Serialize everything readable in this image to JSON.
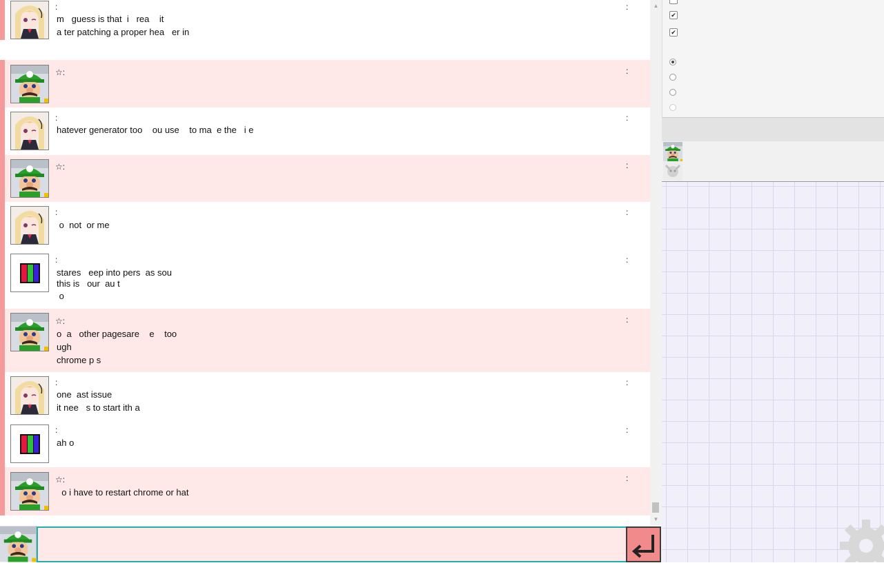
{
  "chat": {
    "messages": [
      {
        "style": "white",
        "avatar": "girl",
        "name": ":",
        "time": ":",
        "lines": [
          "m   guess is that  i   rea    it",
          "a ter patching a proper hea   er in"
        ]
      },
      {
        "style": "pink",
        "avatar": "luigi",
        "name": "☆:",
        "time": ":",
        "lines": []
      },
      {
        "style": "white",
        "avatar": "girl",
        "name": ":",
        "time": ":",
        "lines": [
          "hatever generator too    ou use    to ma  e the   i e"
        ]
      },
      {
        "style": "pink",
        "avatar": "luigi",
        "name": "☆:",
        "time": ":",
        "lines": []
      },
      {
        "style": "white",
        "avatar": "girl",
        "name": ":",
        "time": ":",
        "lines": [
          " o  not  or me"
        ]
      },
      {
        "style": "white",
        "avatar": "bars",
        "name": ":",
        "time": ":",
        "lines": [
          "stares   eep into pers  as sou",
          "this is   our  au t",
          " o"
        ]
      },
      {
        "style": "pink",
        "avatar": "luigi",
        "name": "☆:",
        "time": ":",
        "lines": [
          "o  a   other pagesare    e    too",
          "ugh",
          "chrome p s"
        ]
      },
      {
        "style": "white",
        "avatar": "girl",
        "name": ":",
        "time": ":",
        "lines": [
          "one  ast issue",
          "it nee   s to start ith a"
        ]
      },
      {
        "style": "white",
        "avatar": "bars",
        "name": ":",
        "time": ":",
        "lines": [
          "ah o"
        ]
      },
      {
        "style": "pink",
        "avatar": "luigi",
        "name": "☆:",
        "time": ":",
        "lines": [
          "  o i have to restart chrome or hat"
        ]
      }
    ]
  },
  "input": {
    "value": "",
    "placeholder": ""
  },
  "settings": {
    "checkboxes": [
      {
        "checked": false
      },
      {
        "checked": true
      },
      {
        "checked": true
      }
    ],
    "radios": [
      {
        "selected": true
      },
      {
        "selected": false
      },
      {
        "selected": false
      },
      {
        "selected": false,
        "disabled": true
      }
    ]
  },
  "icons": {
    "send": "enter-arrow-icon",
    "scroll_up": "scroll-up-arrow-icon",
    "scroll_down": "scroll-down-arrow-icon",
    "gear": "gear-icon"
  },
  "colors": {
    "pink_row": "#ffe8e8",
    "accent_bar": "#f49a9a",
    "input_border": "#20b2aa",
    "send_button": "#f18a8a"
  }
}
